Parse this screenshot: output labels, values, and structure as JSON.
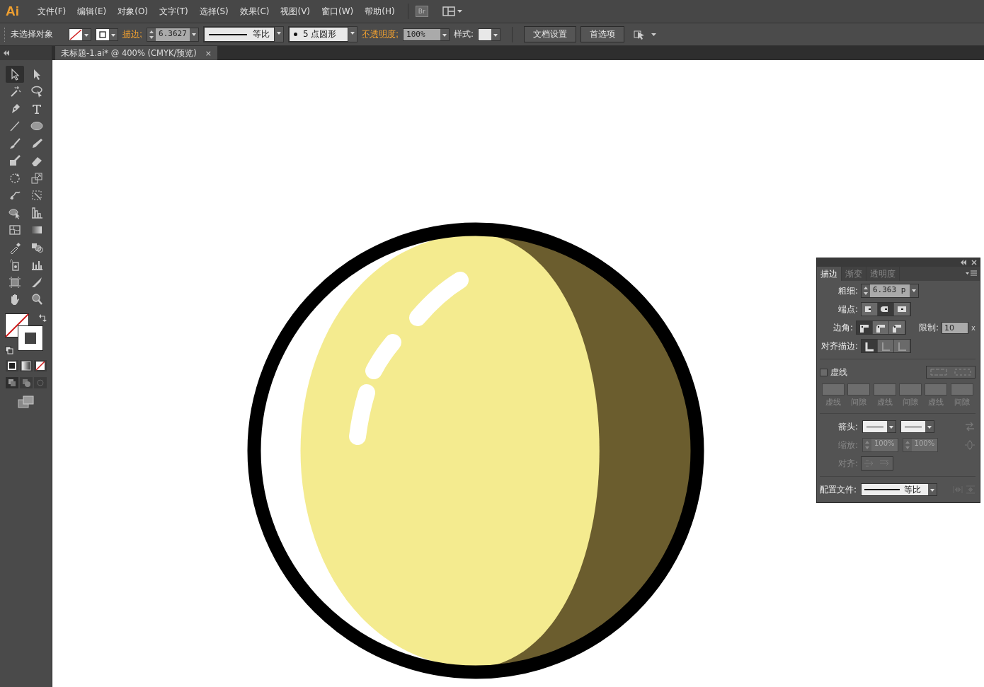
{
  "app": {
    "logo": "Ai",
    "bridge_button": "Br"
  },
  "menu": [
    "文件(F)",
    "编辑(E)",
    "对象(O)",
    "文字(T)",
    "选择(S)",
    "效果(C)",
    "视图(V)",
    "窗口(W)",
    "帮助(H)"
  ],
  "control_bar": {
    "selection": "未选择对象",
    "stroke_label": "描边:",
    "stroke_weight": "6.3627",
    "profile": "等比",
    "brush": "5 点圆形",
    "opacity_label": "不透明度:",
    "opacity": "100%",
    "style_label": "样式:",
    "buttons": [
      "文档设置",
      "首选项"
    ]
  },
  "document_tab": {
    "title": "未标题-1.ai* @ 400% (CMYK/预览)",
    "close": "×"
  },
  "toolbar": {
    "tools": [
      {
        "kind": "selection",
        "selected": true
      },
      {
        "kind": "direct-selection",
        "selected": false
      },
      {
        "kind": "magic-wand",
        "selected": false
      },
      {
        "kind": "lasso",
        "selected": false
      },
      {
        "kind": "pen",
        "selected": false
      },
      {
        "kind": "type",
        "selected": false
      },
      {
        "kind": "line",
        "selected": false
      },
      {
        "kind": "ellipse",
        "selected": false
      },
      {
        "kind": "paintbrush",
        "selected": false
      },
      {
        "kind": "pencil",
        "selected": false
      },
      {
        "kind": "blob-brush",
        "selected": false
      },
      {
        "kind": "eraser",
        "selected": false
      },
      {
        "kind": "rotate",
        "selected": false
      },
      {
        "kind": "scale",
        "selected": false
      },
      {
        "kind": "warp",
        "selected": false
      },
      {
        "kind": "free-transform",
        "selected": false
      },
      {
        "kind": "shape-builder",
        "selected": false
      },
      {
        "kind": "perspective-grid",
        "selected": false
      },
      {
        "kind": "mesh",
        "selected": false
      },
      {
        "kind": "gradient",
        "selected": false
      },
      {
        "kind": "eyedropper",
        "selected": false
      },
      {
        "kind": "blend",
        "selected": false
      },
      {
        "kind": "symbol-sprayer",
        "selected": false
      },
      {
        "kind": "column-graph",
        "selected": false
      },
      {
        "kind": "artboard",
        "selected": false
      },
      {
        "kind": "slice",
        "selected": false
      },
      {
        "kind": "hand",
        "selected": false
      },
      {
        "kind": "zoom",
        "selected": false
      }
    ]
  },
  "stroke_panel": {
    "tabs": [
      {
        "label": "描边",
        "selected": true
      },
      {
        "label": "渐变",
        "selected": false
      },
      {
        "label": "透明度",
        "selected": false
      }
    ],
    "weight_label": "粗细:",
    "weight": "6.363 p",
    "cap_label": "端点:",
    "caps": [
      {
        "selected": false
      },
      {
        "selected": true
      },
      {
        "selected": false
      }
    ],
    "corner_label": "边角:",
    "corners": [
      {
        "selected": true
      },
      {
        "selected": false
      },
      {
        "selected": false
      }
    ],
    "limit_label": "限制:",
    "limit": "10",
    "limit_unit": "x",
    "align_label": "对齐描边:",
    "aligns": [
      {
        "selected": true
      },
      {
        "selected": false
      },
      {
        "selected": false
      }
    ],
    "dashed": {
      "label": "虚线",
      "checked": false
    },
    "dash_fields": [
      "虚线",
      "间隙",
      "虚线",
      "间隙",
      "虚线",
      "间隙"
    ],
    "arrowheads_label": "箭头:",
    "scale_label": "缩放:",
    "scales": [
      "100%",
      "100%"
    ],
    "arrow_align_label": "对齐:",
    "profile_label": "配置文件:",
    "profile": "等比"
  }
}
